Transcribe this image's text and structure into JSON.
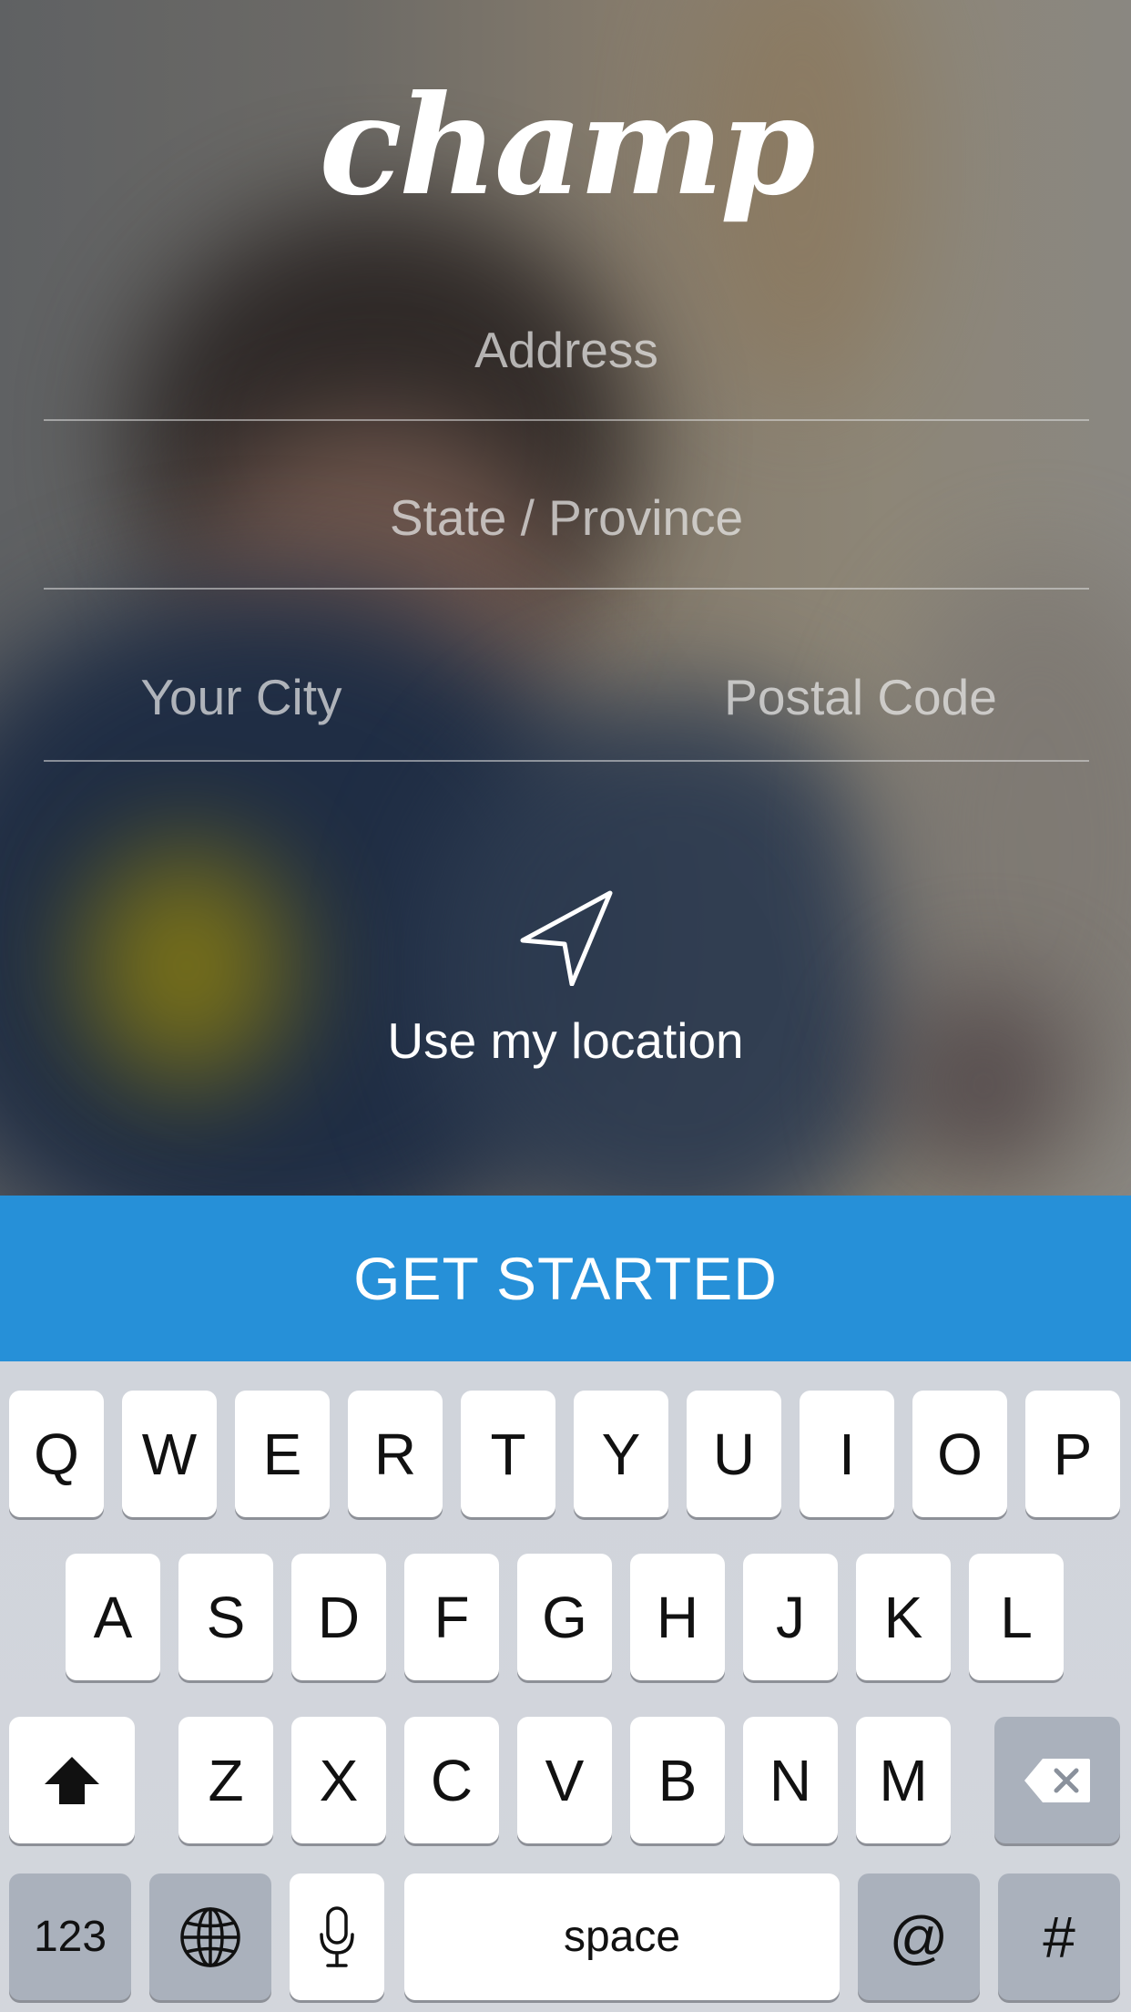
{
  "app": {
    "logo_text": "champ"
  },
  "form": {
    "address_placeholder": "Address",
    "state_placeholder": "State / Province",
    "city_placeholder": "Your City",
    "postal_placeholder": "Postal Code"
  },
  "location": {
    "icon": "navigation-arrow-icon",
    "label": "Use my location"
  },
  "cta": {
    "label": "GET STARTED",
    "color": "#2690d8"
  },
  "keyboard": {
    "row1": [
      "Q",
      "W",
      "E",
      "R",
      "T",
      "Y",
      "U",
      "I",
      "O",
      "P"
    ],
    "row2": [
      "A",
      "S",
      "D",
      "F",
      "G",
      "H",
      "J",
      "K",
      "L"
    ],
    "row3": [
      "Z",
      "X",
      "C",
      "V",
      "B",
      "N",
      "M"
    ],
    "numbers_key": "123",
    "space_key": "space",
    "at_key": "@",
    "hash_key": "#",
    "icons": {
      "shift": "shift-icon",
      "delete": "delete-icon",
      "globe": "globe-icon",
      "mic": "microphone-icon"
    }
  }
}
